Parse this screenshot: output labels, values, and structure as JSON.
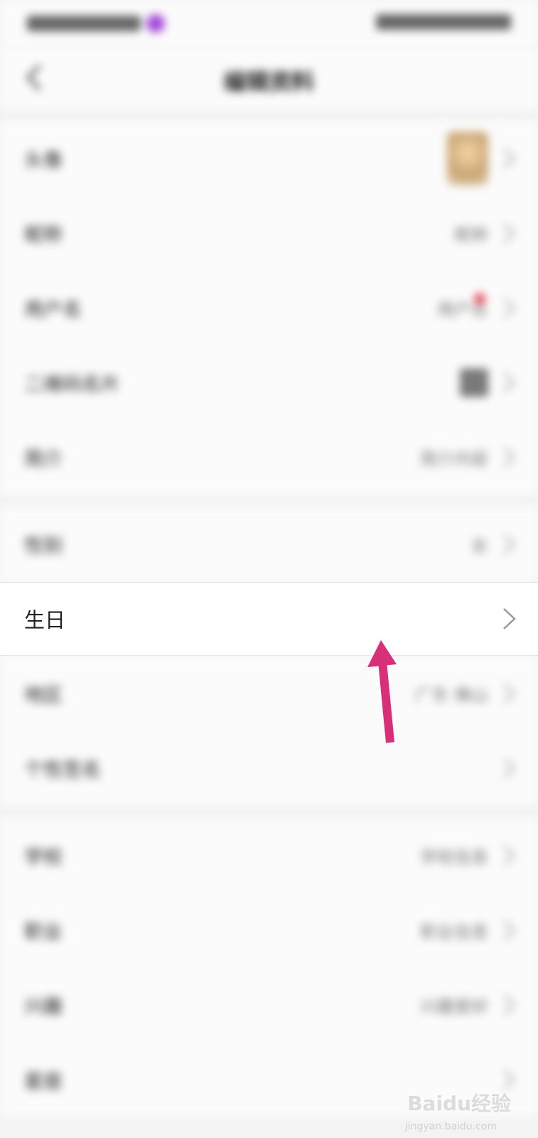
{
  "status_bar": {
    "left_text": "中国移动",
    "right_text": "4G 电池 10:00"
  },
  "header": {
    "back_label": "返回",
    "title": "编辑资料"
  },
  "sections": [
    {
      "rows": [
        {
          "label": "头像",
          "value": "",
          "type": "avatar"
        },
        {
          "label": "昵称",
          "value": "昵称",
          "type": "text"
        },
        {
          "label": "用户名",
          "value": "用户名",
          "type": "badge"
        },
        {
          "label": "二维码名片",
          "value": "",
          "type": "qr"
        },
        {
          "label": "简介",
          "value": "简介内容",
          "type": "text"
        }
      ]
    },
    {
      "rows": [
        {
          "label": "性别",
          "value": "女",
          "type": "text"
        },
        {
          "label": "生日",
          "value": "",
          "type": "focus"
        },
        {
          "label": "地区",
          "value": "广东 佛山",
          "type": "text"
        },
        {
          "label": "个性签名",
          "value": "",
          "type": "text"
        }
      ]
    },
    {
      "rows": [
        {
          "label": "学校",
          "value": "学校信息",
          "type": "text"
        },
        {
          "label": "职业",
          "value": "职业信息",
          "type": "text"
        },
        {
          "label": "兴趣",
          "value": "兴趣爱好",
          "type": "text"
        },
        {
          "label": "星座",
          "value": "",
          "type": "text"
        }
      ]
    }
  ],
  "focus_row": {
    "label": "生日"
  },
  "watermark": {
    "brand": "Baidu经验",
    "url": "jingyan.baidu.com"
  },
  "colors": {
    "arrow": "#d92f78",
    "background": "#f3f3f3",
    "row_background": "#fbfbfb"
  }
}
